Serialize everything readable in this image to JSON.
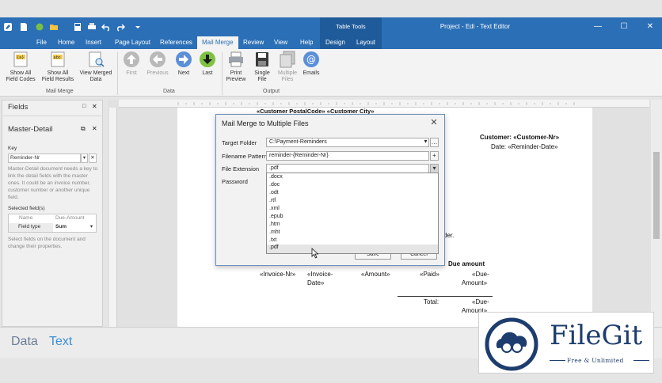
{
  "window": {
    "title": "Project - Edi - Text Editor",
    "context_tab": "Table Tools",
    "minimize": "—",
    "maximize": "☐",
    "close": "✕"
  },
  "quick_access": [
    "app-icon",
    "new-icon",
    "open-icon",
    "folder-icon",
    "save-icon",
    "print-icon",
    "undo-icon",
    "redo-icon",
    "customize-icon"
  ],
  "menu_tabs": [
    "File",
    "Home",
    "Insert",
    "Page Layout",
    "References",
    "Mail Merge",
    "Review",
    "View",
    "Help",
    "Design",
    "Layout"
  ],
  "active_tab": "Mail Merge",
  "ribbon": {
    "groups": {
      "mail_merge": "Mail Merge",
      "data": "Data",
      "output": "Output"
    },
    "buttons": {
      "show_all_field_codes": "Show All\nField Codes",
      "show_all_field_results": "Show All\nField Results",
      "view_merged_data": "View Merged\nData",
      "first": "First",
      "previous": "Previous",
      "next": "Next",
      "last": "Last",
      "print_preview": "Print\nPreview",
      "single_file": "Single\nFile",
      "multiple_files": "Multiple\nFiles",
      "emails": "Emails"
    }
  },
  "left_panel": {
    "fields_title": "Fields",
    "master_detail_title": "Master-Detail",
    "key_label": "Key",
    "key_value": "Reminder-Nr",
    "description": "Master-Detail document needs a key to link the detail fields with the master ones. It could be an invoice number, customer number or another unique field.",
    "selected_fields_label": "Selected field(s)",
    "table": {
      "headers": [
        "Name",
        "Due-Amount"
      ],
      "row_label": "Field type",
      "row_value": "Sum"
    },
    "hint": "Select fields on the document and change their properties."
  },
  "document": {
    "top_line": "«Customer PostalCode» «Customer City»",
    "customer_line": "Customer: «Customer-Nr»",
    "date_line": "Date: «Reminder-Date»",
    "order_fragment": "der.",
    "due_amount_header": "Due amount",
    "cells": {
      "invoice_nr": "«Invoice-Nr»",
      "invoice_date_1": "«Invoice-",
      "invoice_date_2": "Date»",
      "amount": "«Amount»",
      "paid": "«Paid»",
      "due_1": "«Due-",
      "due_2": "Amount»",
      "total_label": "Total:",
      "total_due_1": "«Due-",
      "total_due_2": "Amount»"
    }
  },
  "dialog": {
    "title": "Mail Merge to Multiple Files",
    "close": "✕",
    "target_folder_label": "Target Folder",
    "target_folder_value": "C:\\Payment-Reminders",
    "filename_pattern_label": "Filename Pattern",
    "filename_pattern_value": "reminder-{Reminder-Nr}",
    "file_extension_label": "File Extension",
    "file_extension_value": ".pdf",
    "password_label": "Password",
    "extension_options": [
      ".docx",
      ".doc",
      ".odt",
      ".rtf",
      ".xml",
      ".epub",
      ".htm",
      ".mht",
      ".txt",
      ".pdf"
    ],
    "save_button": "Save",
    "cancel_button": "Cancel"
  },
  "bottom_tabs": [
    "Data",
    "Text"
  ],
  "watermark": {
    "name": "FileGit",
    "tagline": "Free & Unlimited"
  },
  "colors": {
    "accent": "#2b6fb6",
    "context_tab": "#1f5b9a",
    "brand": "#1d3d6e"
  }
}
